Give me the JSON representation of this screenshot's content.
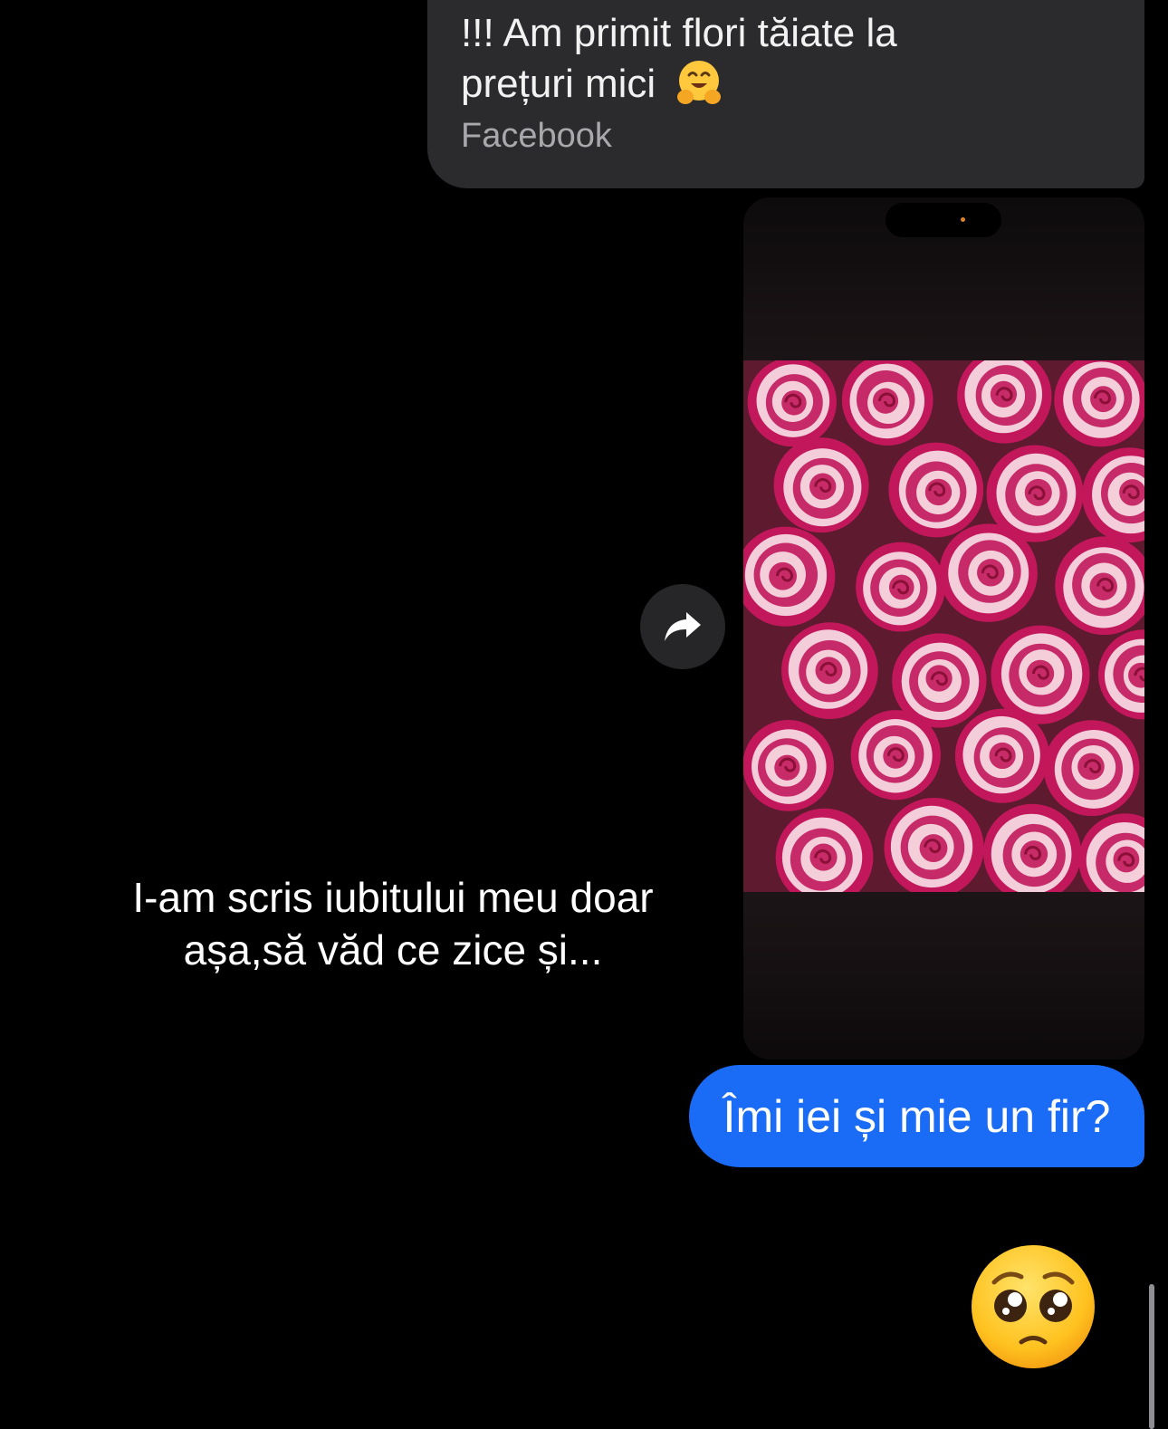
{
  "shared_post": {
    "caption_line1": "!!! Am primit flori tăiate la",
    "caption_line2": "prețuri mici",
    "caption_emoji": "hugging-face-emoji",
    "source": "Facebook"
  },
  "image_card": {
    "content": "roses-photo",
    "accent_colors": [
      "#c2185b",
      "#f8e1e7"
    ]
  },
  "share_button": {
    "icon": "forward-arrow-icon"
  },
  "overlay_text": {
    "line1": "I-am scris iubitului meu doar",
    "line2": "așa,să văd ce zice și..."
  },
  "sent_message": {
    "text": "Îmi iei și mie un fir?",
    "color": "#1a6bf5"
  },
  "reply_emoji": {
    "icon": "pleading-face-emoji"
  }
}
